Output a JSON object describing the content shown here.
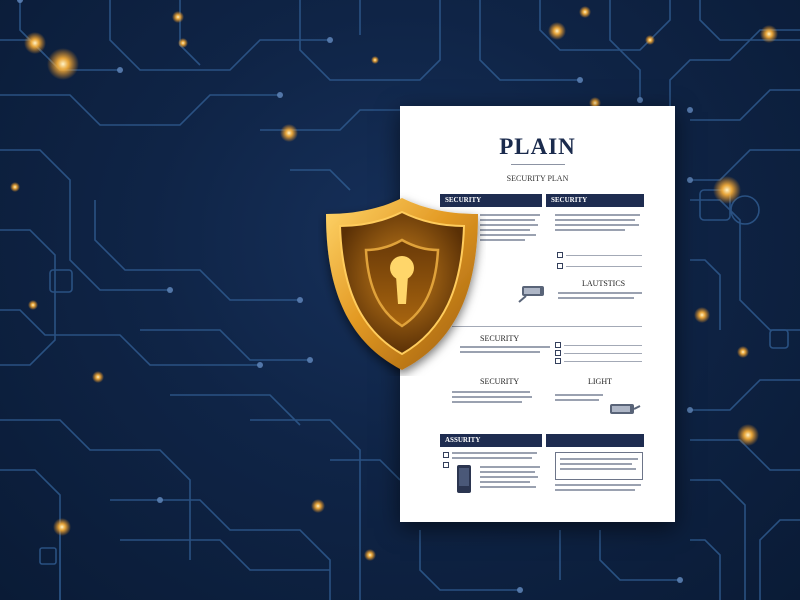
{
  "document": {
    "title": "PLAIN",
    "subtitle": "SECURITY PLAN",
    "bar_labels": [
      "SECURITY",
      "SECURITY",
      "ASSURITY"
    ],
    "section_labels": [
      "LAUTSTICS",
      "SECURITY",
      "SECURITY",
      "LIGHT"
    ]
  },
  "colors": {
    "background": "#0f2446",
    "circuit_line": "#2f5a8e",
    "node_glow": "#ffb43a",
    "shield_gold": "#d8891e",
    "document_bar": "#1e2c50"
  },
  "icons": [
    "shield-icon",
    "keyhole-icon",
    "camera-icon",
    "phone-icon"
  ]
}
